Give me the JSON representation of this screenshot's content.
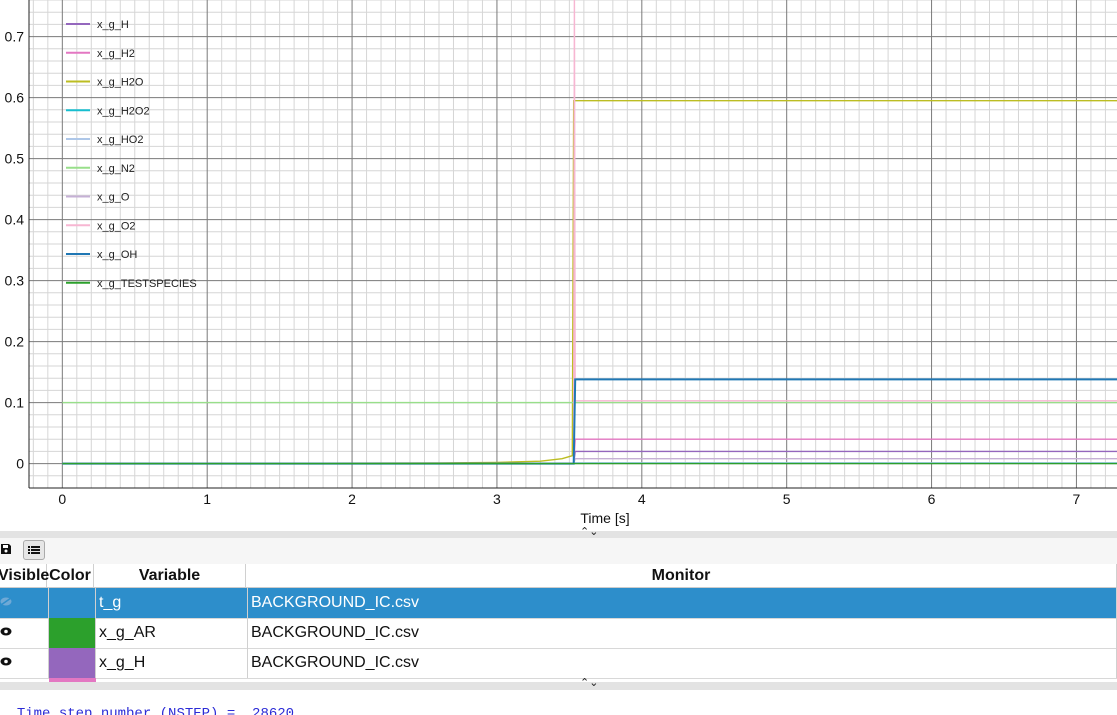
{
  "chart_data": {
    "type": "line",
    "xlabel": "Time [s]",
    "ylabel": "",
    "xlim": [
      -0.23,
      7.28
    ],
    "ylim": [
      -0.04,
      0.76
    ],
    "x_ticks": [
      "0",
      "1",
      "2",
      "3",
      "4",
      "5",
      "6",
      "7"
    ],
    "y_ticks": [
      "0",
      "0.1",
      "0.2",
      "0.3",
      "0.4",
      "0.5",
      "0.6",
      "0.7"
    ],
    "grid": true,
    "legend_position": "top-left",
    "series": [
      {
        "name": "x_g_H",
        "color": "#9467bd",
        "x": [
          0,
          3.53,
          3.54,
          7.28
        ],
        "y": [
          0,
          0,
          0.02,
          0.02
        ]
      },
      {
        "name": "x_g_H2",
        "color": "#e377c2",
        "x": [
          0,
          3.53,
          3.54,
          7.28
        ],
        "y": [
          0,
          0,
          0.04,
          0.04
        ]
      },
      {
        "name": "x_g_H2O",
        "color": "#bcbd22",
        "x": [
          0,
          2.6,
          3.0,
          3.3,
          3.45,
          3.52,
          3.53,
          7.28
        ],
        "y": [
          0,
          0.001,
          0.002,
          0.004,
          0.008,
          0.013,
          0.595,
          0.595
        ]
      },
      {
        "name": "x_g_H2O2",
        "color": "#17becf",
        "x": [
          0,
          3.53,
          3.54,
          7.28
        ],
        "y": [
          0,
          0,
          0.001,
          0.001
        ]
      },
      {
        "name": "x_g_HO2",
        "color": "#aec7e8",
        "x": [
          0,
          3.53,
          3.54,
          7.28
        ],
        "y": [
          0,
          0,
          0.001,
          0.001
        ]
      },
      {
        "name": "x_g_N2",
        "color": "#98df8a",
        "x": [
          0,
          3.53,
          3.54,
          7.28
        ],
        "y": [
          0.1,
          0.1,
          0.1,
          0.1
        ]
      },
      {
        "name": "x_g_O",
        "color": "#c5b0d5",
        "x": [
          0,
          3.53,
          3.54,
          7.28
        ],
        "y": [
          0,
          0,
          0.008,
          0.008
        ]
      },
      {
        "name": "x_g_O2",
        "color": "#f7b6d2",
        "x": [
          0,
          3.53,
          3.535,
          3.54,
          7.28
        ],
        "y": [
          0,
          0,
          0.78,
          0.103,
          0.103
        ]
      },
      {
        "name": "x_g_OH",
        "color": "#1f77b4",
        "x": [
          0,
          3.53,
          3.54,
          7.28
        ],
        "y": [
          0,
          0,
          0.138,
          0.138
        ]
      },
      {
        "name": "x_g_TESTSPECIES",
        "color": "#2ca02c",
        "x": [
          0,
          7.28
        ],
        "y": [
          0,
          0
        ]
      }
    ]
  },
  "toolbar": {
    "save_icon": "save-icon",
    "list_icon": "list-icon"
  },
  "table": {
    "headers": {
      "visible": "Visible",
      "color": "Color",
      "variable": "Variable",
      "monitor": "Monitor"
    },
    "rows": [
      {
        "variable": "t_g",
        "monitor": "BACKGROUND_IC.csv",
        "color": "#2d8ecb",
        "visible": false,
        "selected": true
      },
      {
        "variable": "x_g_AR",
        "monitor": "BACKGROUND_IC.csv",
        "color": "#2ca02c",
        "visible": true,
        "selected": false
      },
      {
        "variable": "x_g_H",
        "monitor": "BACKGROUND_IC.csv",
        "color": "#9467bd",
        "visible": true,
        "selected": false
      }
    ],
    "partial_row_color": "#e377c2"
  },
  "console": {
    "line1": "Time step number (NSTEP) =  28620"
  }
}
